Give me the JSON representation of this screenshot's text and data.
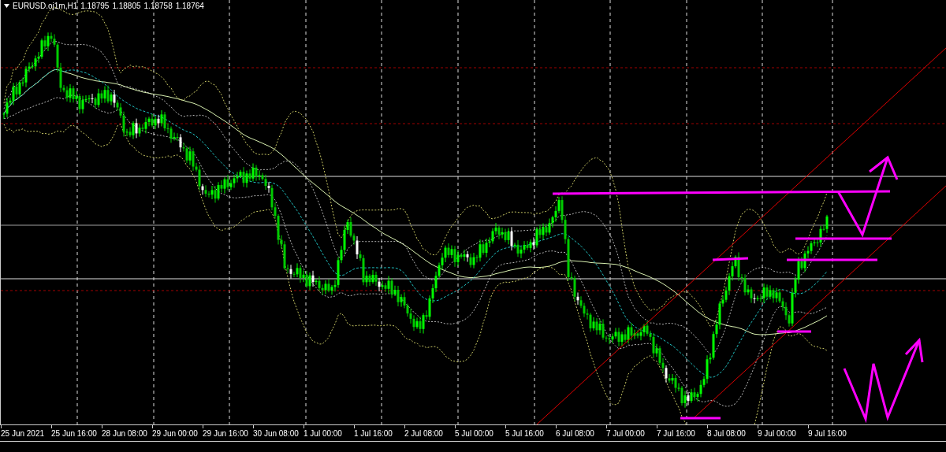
{
  "chart": {
    "symbol": "EURUSD.oj1m,H1",
    "prices": [
      "1.18795",
      "1.18805",
      "1.18758",
      "1.18764"
    ]
  },
  "time_axis": {
    "labels": [
      "25 Jun 2021",
      "25 Jun 16:00",
      "28 Jun 08:00",
      "29 Jun 00:00",
      "29 Jun 16:00",
      "30 Jun 08:00",
      "1 Jul 00:00",
      "1 Jul 16:00",
      "2 Jul 08:00",
      "5 Jul 00:00",
      "5 Jul 16:00",
      "6 Jul 08:00",
      "7 Jul 00:00",
      "7 Jul 16:00",
      "8 Jul 08:00",
      "9 Jul 00:00",
      "9 Jul 16:00"
    ]
  }
}
